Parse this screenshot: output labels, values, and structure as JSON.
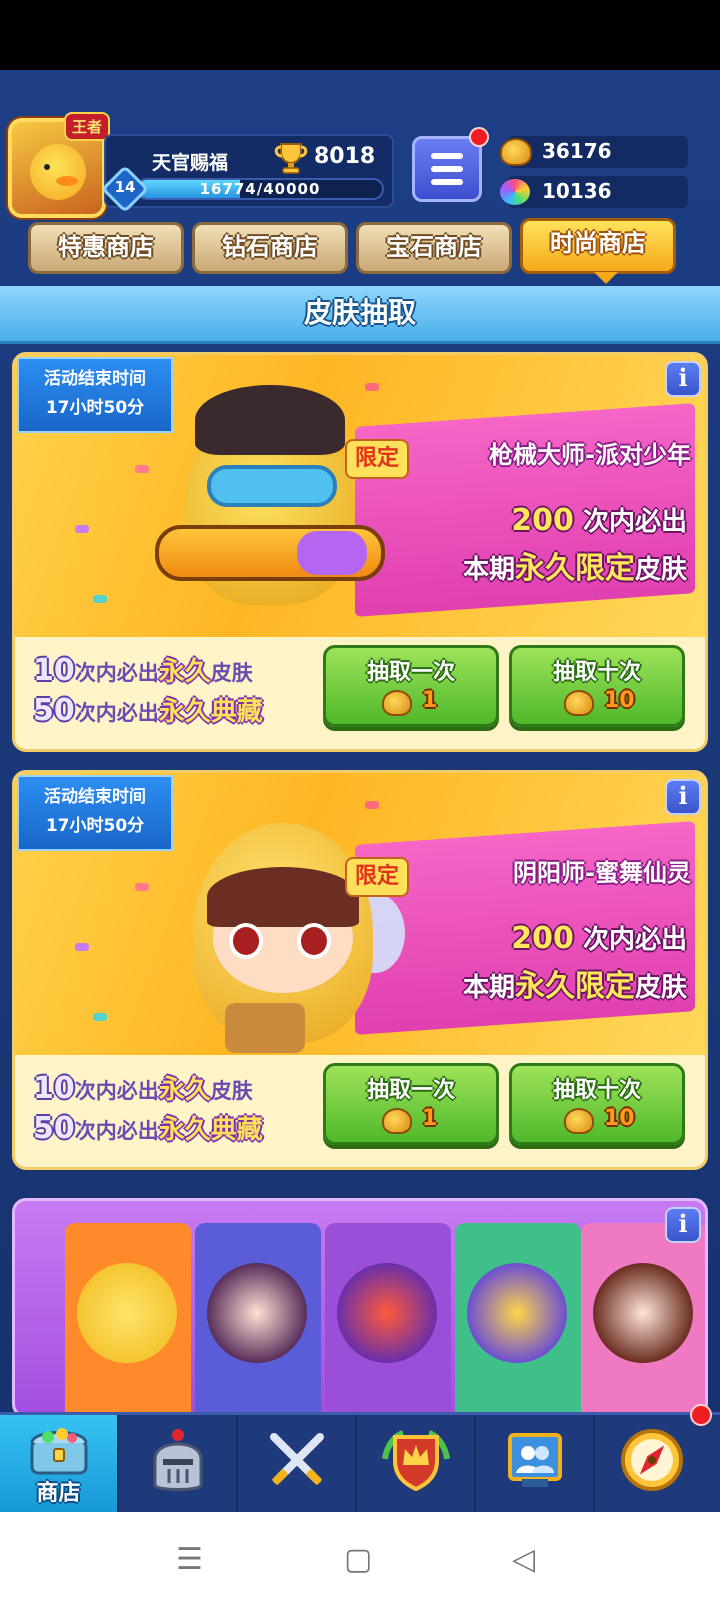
{
  "player": {
    "name": "天官赐福",
    "avatar_tag": "王者",
    "level": "14",
    "xp_text": "16774/40000",
    "xp_fraction": 0.419,
    "trophies": "8018"
  },
  "currency": {
    "masks": "36176",
    "gems": "10136"
  },
  "shop_tabs": [
    {
      "label": "特惠商店",
      "active": false
    },
    {
      "label": "钻石商店",
      "active": false
    },
    {
      "label": "宝石商店",
      "active": false
    },
    {
      "label": "时尚商店",
      "active": true
    }
  ],
  "section_title": "皮肤抽取",
  "banners": [
    {
      "timer_line1": "活动结束时间",
      "timer_line2": "17小时50分",
      "info": "i",
      "limited_tag": "限定",
      "skin_name": "枪械大师-派对少年",
      "guarantee_num": "200",
      "guarantee_text": "次内必出",
      "line2_prefix": "本期",
      "line2_highlight": "永久限定",
      "line2_suffix": "皮肤",
      "reward1_num": "10",
      "reward1_text": "次内必出",
      "reward1_highlight": "永久",
      "reward1_suffix": "皮肤",
      "reward2_num": "50",
      "reward2_text": "次内必出",
      "reward2_highlight": "永久典藏",
      "draw_once_label": "抽取一次",
      "draw_once_cost": "1",
      "draw_ten_label": "抽取十次",
      "draw_ten_cost": "10"
    },
    {
      "timer_line1": "活动结束时间",
      "timer_line2": "17小时50分",
      "info": "i",
      "limited_tag": "限定",
      "skin_name": "阴阳师-蜜舞仙灵",
      "guarantee_num": "200",
      "guarantee_text": "次内必出",
      "line2_prefix": "本期",
      "line2_highlight": "永久限定",
      "line2_suffix": "皮肤",
      "reward1_num": "10",
      "reward1_text": "次内必出",
      "reward1_highlight": "永久",
      "reward1_suffix": "皮肤",
      "reward2_num": "50",
      "reward2_text": "次内必出",
      "reward2_highlight": "永久典藏",
      "draw_once_label": "抽取一次",
      "draw_once_cost": "1",
      "draw_ten_label": "抽取十次",
      "draw_ten_cost": "10"
    }
  ],
  "banner3": {
    "info": "i"
  },
  "bottom_nav": [
    {
      "label": "商店",
      "icon": "treasure-chest-icon",
      "active": true
    },
    {
      "label": "",
      "icon": "knight-helmet-icon",
      "active": false
    },
    {
      "label": "",
      "icon": "crossed-swords-icon",
      "active": false
    },
    {
      "label": "",
      "icon": "crown-shield-icon",
      "active": false
    },
    {
      "label": "",
      "icon": "social-board-icon",
      "active": false
    },
    {
      "label": "",
      "icon": "compass-icon",
      "active": false
    }
  ],
  "system_nav": {
    "menu": "☰",
    "home": "▢",
    "back": "◁"
  },
  "colors": {
    "background": "#1b3a7c",
    "tab_active": "#f5a91a",
    "draw_button": "#4fb82a",
    "section_header": "#4aaee8",
    "notification": "#ee1d24"
  }
}
